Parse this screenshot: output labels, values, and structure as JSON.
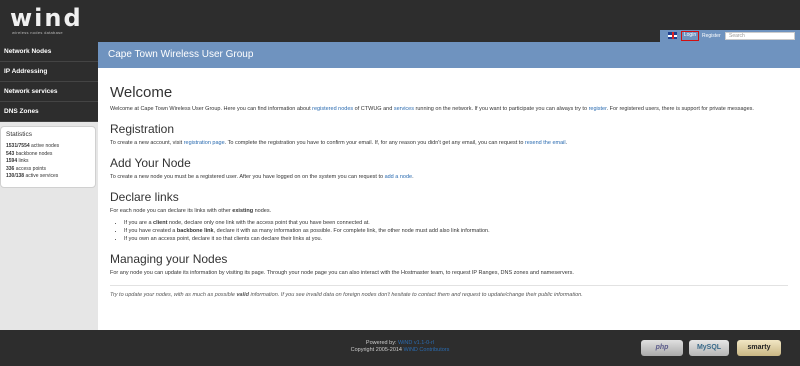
{
  "header": {
    "logo_word": "wind",
    "logo_tagline": "wireless nodes database",
    "site_title": "Cape Town Wireless User Group",
    "login_label": "Login",
    "register_label": "Register",
    "search_placeholder": "Search"
  },
  "sidebar": {
    "items": [
      {
        "label": "Network Nodes"
      },
      {
        "label": "IP Addressing"
      },
      {
        "label": "Network services"
      },
      {
        "label": "DNS Zones"
      }
    ],
    "stats": {
      "title": "Statistics",
      "lines": [
        {
          "value": "1531/7554",
          "label": "active nodes"
        },
        {
          "value": "543",
          "label": "backbone nodes"
        },
        {
          "value": "1594",
          "label": "links"
        },
        {
          "value": "336",
          "label": "access points"
        },
        {
          "value": "130/138",
          "label": "active services"
        }
      ]
    }
  },
  "main": {
    "welcome": {
      "title": "Welcome",
      "p1": "Welcome at Cape Town Wireless User Group. Here you can find information about ",
      "link_nodes": "registered nodes",
      "p2": " of CTWUG and ",
      "link_services": "services",
      "p3": " running on the network. If you want to participate you can always try to ",
      "link_register": "register",
      "p4": ". For registered users, there is support for private messages."
    },
    "registration": {
      "title": "Registration",
      "p1": "To create a new account, visit ",
      "link_page": "registration page",
      "p2": ". To complete the registration you have to confirm your email. If, for any reason you didn't get any email, you can request to ",
      "link_resend": "resend the email",
      "p3": "."
    },
    "add_node": {
      "title": "Add Your Node",
      "p1": "To create a new node you must be a registered user. After you have logged on on the system you can request to ",
      "link_add": "add a node",
      "p2": "."
    },
    "declare_links": {
      "title": "Declare links",
      "intro1": "For each node you can declare its links with other ",
      "intro_bold": "existing",
      "intro2": " nodes.",
      "b1_pre": "If you are a ",
      "b1_bold": "client",
      "b1_post": " node, declare only one link with the access point that you have been connected at.",
      "b2_pre": "If you have created a ",
      "b2_bold": "backbone link",
      "b2_post": ", declare it with as many information as possible. For complete link, the other node must add also link information.",
      "b3": "If you own an access point, declare it so that clients can declare their links at you."
    },
    "managing": {
      "title": "Managing your Nodes",
      "p": "For any node you can update its information by visiting its page. Through your node page you can also interact with the Hostmaster team, to request IP Ranges, DNS zones and nameservers."
    },
    "footnote": {
      "p1": "Try to update your nodes, with as much as possible ",
      "bold": "valid",
      "p2": " information. If you see invalid data on foreign nodes don't hesitate to contact them and request to update/change their public information."
    }
  },
  "footer": {
    "powered_by": "Powered by: ",
    "wind_link": "WiND v1.1-0-rl",
    "copyright": "Copyright 2005-2014 ",
    "contributors_link": "WiND Contributors",
    "badges": [
      "php",
      "MySQL",
      "smarty"
    ]
  }
}
